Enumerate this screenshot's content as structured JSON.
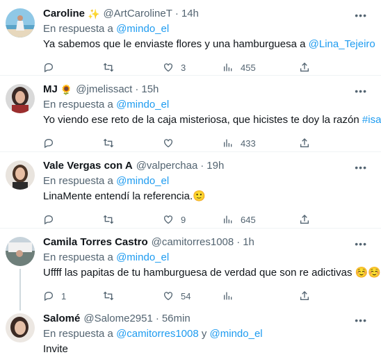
{
  "tweets": [
    {
      "name": "Caroline",
      "emoji": "✨",
      "handle": "@ArtCarolineT",
      "time": "14h",
      "reply_prefix": "En respuesta a",
      "reply_to": "@mindo_el",
      "reply_extra": "",
      "text_before": "Ya sabemos que le enviaste flores y una hamburguesa a ",
      "text_link": "@Lina_Tejeiro",
      "text_after": "",
      "replies": "",
      "retweets": "",
      "likes": "3",
      "views": "455"
    },
    {
      "name": "MJ",
      "emoji": "🌻",
      "handle": "@jmelissact",
      "time": "15h",
      "reply_prefix": "En respuesta a",
      "reply_to": "@mindo_el",
      "reply_extra": "",
      "text_before": "Yo viendo ese reto de la caja misteriosa, que hicistes te doy la razón ",
      "text_link": "#isa",
      "text_after": "",
      "replies": "",
      "retweets": "",
      "likes": "",
      "views": "433"
    },
    {
      "name": "Vale Vergas con A",
      "emoji": "",
      "handle": "@valperchaa",
      "time": "19h",
      "reply_prefix": "En respuesta a",
      "reply_to": "@mindo_el",
      "reply_extra": "",
      "text_before": "LinaMente entendí la referencia.🙂",
      "text_link": "",
      "text_after": "",
      "replies": "",
      "retweets": "",
      "likes": "9",
      "views": "645"
    },
    {
      "name": "Camila Torres Castro",
      "emoji": "",
      "handle": "@camitorres1008",
      "time": "1h",
      "reply_prefix": "En respuesta a",
      "reply_to": "@mindo_el",
      "reply_extra": "",
      "text_before": "Uffff las papitas de tu hamburguesa de verdad que son re adictivas ☺️☺️",
      "text_link": "",
      "text_after": "",
      "replies": "1",
      "retweets": "",
      "likes": "54",
      "views": ""
    },
    {
      "name": "Salomé",
      "emoji": "",
      "handle": "@Salome2951",
      "time": "56min",
      "reply_prefix": "En respuesta a",
      "reply_to": "@camitorres1008",
      "reply_joiner": " y ",
      "reply_extra": "@mindo_el",
      "text_before": "Invite",
      "text_link": "",
      "text_after": "",
      "replies": "",
      "retweets": "",
      "likes": "",
      "views": ""
    }
  ],
  "icons": {
    "more": "more-icon",
    "reply": "reply-icon",
    "retweet": "retweet-icon",
    "like": "heart-icon",
    "views": "views-icon",
    "share": "share-icon"
  },
  "colors": {
    "link": "#1d9bf0",
    "muted": "#536471",
    "text": "#0f1419"
  },
  "more_glyph": "•••"
}
